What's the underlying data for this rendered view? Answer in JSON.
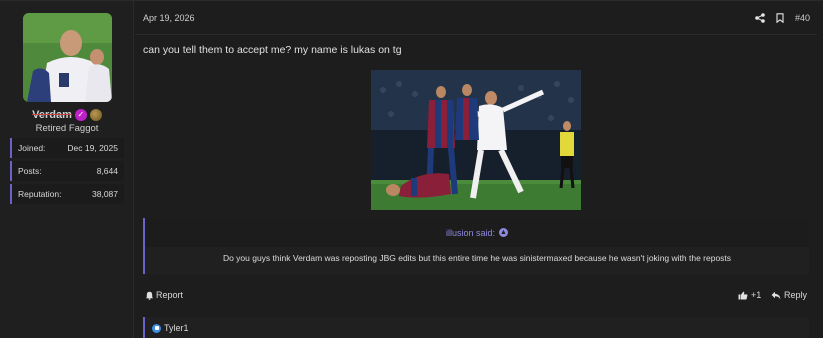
{
  "user": {
    "username": "Verdam",
    "title": "Retired Faggot",
    "stats": [
      {
        "label": "Joined:",
        "value": "Dec 19, 2025"
      },
      {
        "label": "Posts:",
        "value": "8,644"
      },
      {
        "label": "Reputation:",
        "value": "38,087"
      }
    ]
  },
  "post": {
    "date": "Apr 19, 2026",
    "number": "#40",
    "text": "can you tell them to accept me? my name is lukas on tg"
  },
  "quote": {
    "author": "illusion said:",
    "text": "Do you guys think Verdam was reposting JBG edits but this entire time he was sinistermaxed because he wasn't joking with the reposts"
  },
  "actions": {
    "report_label": "Report",
    "like_count": "+1",
    "reply_label": "Reply"
  },
  "reactions": {
    "names": "Tyler1"
  },
  "colors": {
    "accent": "#6b63c9",
    "link": "#8f89e0",
    "badge": "#c020c8",
    "like": "#3d8ee6"
  }
}
